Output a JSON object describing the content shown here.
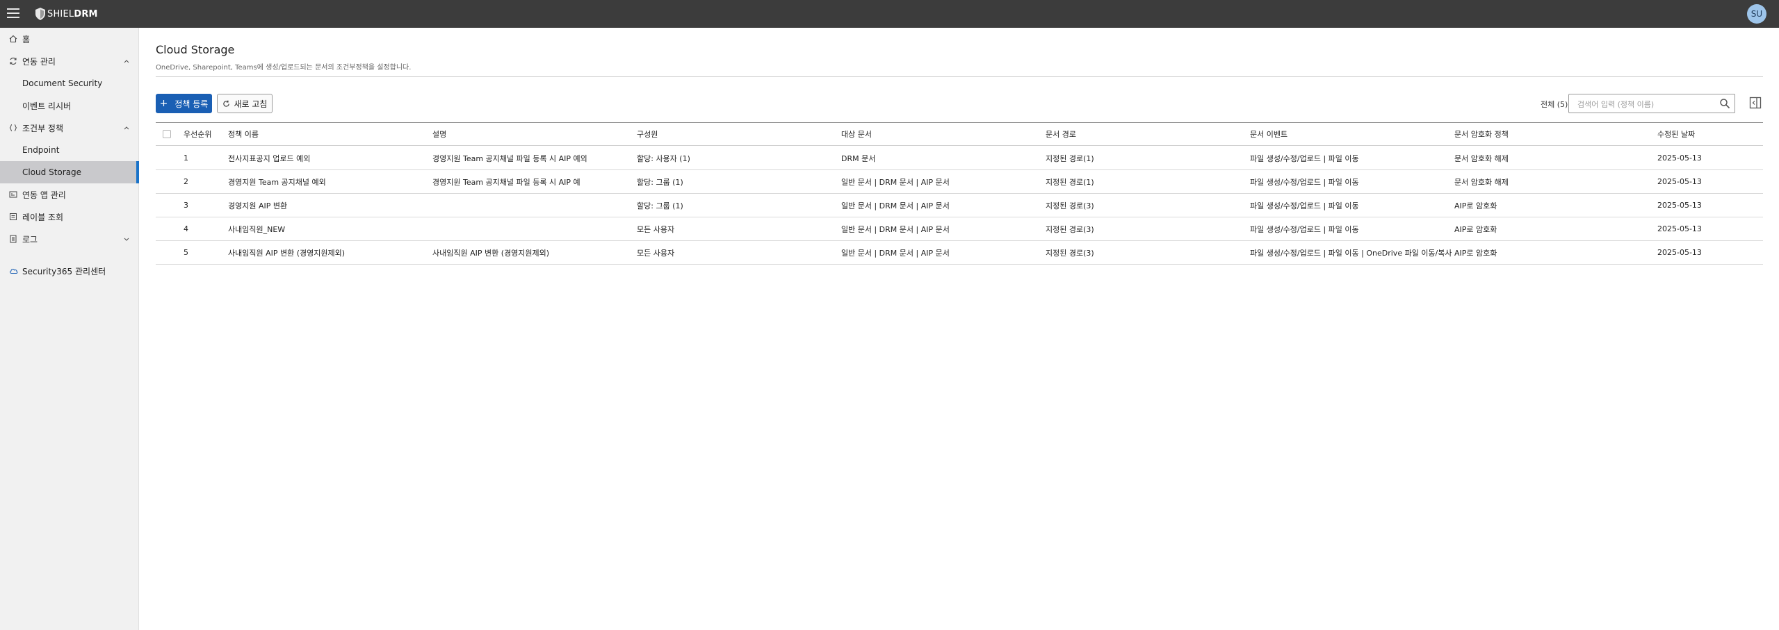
{
  "app": {
    "logo_prefix": "SHIEL",
    "logo_suffix": "DRM",
    "user_initials": "SU"
  },
  "sidebar": {
    "items": [
      {
        "label": "홈",
        "icon": "home-icon"
      },
      {
        "label": "연동 관리",
        "icon": "sync-icon",
        "expanded": true
      },
      {
        "label": "Document Security"
      },
      {
        "label": "이벤트 리시버"
      },
      {
        "label": "조건부 정책",
        "icon": "braces-icon",
        "expanded": true
      },
      {
        "label": "Endpoint"
      },
      {
        "label": "Cloud Storage",
        "active": true
      },
      {
        "label": "연동 앱 관리",
        "icon": "app-icon"
      },
      {
        "label": "레이블 조회",
        "icon": "label-icon"
      },
      {
        "label": "로그",
        "icon": "log-icon",
        "expanded": false
      },
      {
        "label": "Security365 관리센터",
        "icon": "cloud-icon"
      }
    ]
  },
  "page": {
    "title": "Cloud Storage",
    "description": "OneDrive, Sharepoint, Teams에 생성/업로드되는 문서의 조건부정책을 설정합니다."
  },
  "toolbar": {
    "add_label": "정책 등록",
    "refresh_label": "새로 고침",
    "total_label": "전체 (5)",
    "search_placeholder": "검색어 입력 (정책 이름)"
  },
  "table": {
    "headers": {
      "priority": "우선순위",
      "name": "정책 이름",
      "description": "설명",
      "members": "구성원",
      "target_docs": "대상 문서",
      "doc_path": "문서 경로",
      "doc_event": "문서 이벤트",
      "encryption": "문서 암호화 정책",
      "modified": "수정된 날짜"
    },
    "rows": [
      {
        "priority": "1",
        "name": "전사지표공지 업로드 예외",
        "description": "경영지원 Team 공지채널 파일 등록 시 AIP 예외",
        "members": "할당: 사용자 (1)",
        "target_docs": "DRM 문서",
        "doc_path": "지정된 경로(1)",
        "doc_event": "파일 생성/수정/업로드 | 파일 이동",
        "encryption": "문서 암호화 해제",
        "modified": "2025-05-13"
      },
      {
        "priority": "2",
        "name": "경영지원 Team 공지채널 예외",
        "description": "경영지원 Team 공지채널 파일 등록 시 AIP 예",
        "members": "할당: 그룹 (1)",
        "target_docs": "일반 문서 | DRM 문서 | AIP 문서",
        "doc_path": "지정된 경로(1)",
        "doc_event": "파일 생성/수정/업로드 | 파일 이동",
        "encryption": "문서 암호화 해제",
        "modified": "2025-05-13"
      },
      {
        "priority": "3",
        "name": "경영지원 AIP 변환",
        "description": "",
        "members": "할당: 그룹 (1)",
        "target_docs": "일반 문서 | DRM 문서 | AIP 문서",
        "doc_path": "지정된 경로(3)",
        "doc_event": "파일 생성/수정/업로드 | 파일 이동",
        "encryption": "AIP로 암호화",
        "modified": "2025-05-13"
      },
      {
        "priority": "4",
        "name": "사내임직원_NEW",
        "description": "",
        "members": "모든 사용자",
        "target_docs": "일반 문서 | DRM 문서 | AIP 문서",
        "doc_path": "지정된 경로(3)",
        "doc_event": "파일 생성/수정/업로드 | 파일 이동",
        "encryption": "AIP로 암호화",
        "modified": "2025-05-13"
      },
      {
        "priority": "5",
        "name": "사내임직원 AIP 변환 (경영지원제외)",
        "description": "사내임직원 AIP 변환 (경영지원제외)",
        "members": "모든 사용자",
        "target_docs": "일반 문서 | DRM 문서 | AIP 문서",
        "doc_path": "지정된 경로(3)",
        "doc_event": "파일 생성/수정/업로드 | 파일 이동 | OneDrive 파일 이동/복사",
        "encryption": "AIP로 암호화",
        "modified": "2025-05-13"
      }
    ]
  },
  "colors": {
    "topbar": "#3c3c3c",
    "accent": "#1a5fb4",
    "sidebar_bg": "#f1f1f1",
    "active_item": "#c9c9cc"
  }
}
